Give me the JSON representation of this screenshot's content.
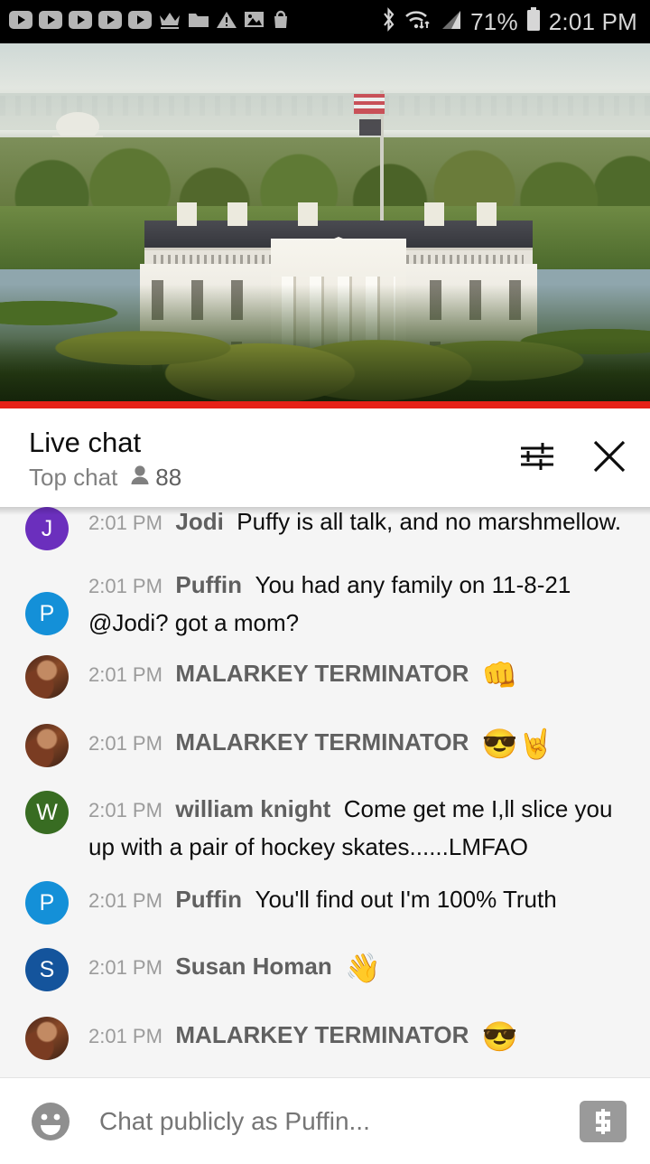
{
  "statusbar": {
    "left_icons": [
      "youtube-play-icon",
      "youtube-play-icon",
      "youtube-play-icon",
      "youtube-play-icon",
      "youtube-play-icon",
      "crown-icon",
      "folder-icon",
      "warning-triangle-icon",
      "image-icon",
      "shopping-bag-icon"
    ],
    "right_icons": [
      "bluetooth-icon",
      "wifi-icon",
      "cellular-signal-icon",
      "battery-icon"
    ],
    "battery_percent": "71%",
    "clock": "2:01 PM"
  },
  "video": {
    "description": "White House live stream with Jefferson Memorial and Potomac River",
    "progress_color": "#e62117"
  },
  "chat_header": {
    "title": "Live chat",
    "subtitle": "Top chat",
    "viewer_count": "88",
    "settings_icon": "tune-sliders-icon",
    "close_icon": "close-icon"
  },
  "messages": [
    {
      "avatar_letter": "J",
      "avatar_color": "#6b2fbd",
      "avatar_type": "letter",
      "time": "2:01 PM",
      "author": "Jodi",
      "text": "Puffy is all talk, and no marshmellow.",
      "emojis": ""
    },
    {
      "avatar_letter": "P",
      "avatar_color": "#1490d8",
      "avatar_type": "letter",
      "time": "2:01 PM",
      "author": "Puffin",
      "text": "You had any family on 11-8-21 @Jodi? got a mom?",
      "emojis": ""
    },
    {
      "avatar_letter": "",
      "avatar_color": "#5a3020",
      "avatar_type": "photo",
      "time": "2:01 PM",
      "author": "MALARKEY TERMINATOR",
      "text": "",
      "emojis": "👊"
    },
    {
      "avatar_letter": "",
      "avatar_color": "#5a3020",
      "avatar_type": "photo",
      "time": "2:01 PM",
      "author": "MALARKEY TERMINATOR",
      "text": "",
      "emojis": "😎🤘"
    },
    {
      "avatar_letter": "W",
      "avatar_color": "#386c22",
      "avatar_type": "letter",
      "time": "2:01 PM",
      "author": "william knight",
      "text": "Come get me I,ll slice you up with a pair of hockey skates......LMFAO",
      "emojis": ""
    },
    {
      "avatar_letter": "P",
      "avatar_color": "#1490d8",
      "avatar_type": "letter",
      "time": "2:01 PM",
      "author": "Puffin",
      "text": "You'll find out I'm 100% Truth",
      "emojis": ""
    },
    {
      "avatar_letter": "S",
      "avatar_color": "#14549c",
      "avatar_type": "letter",
      "time": "2:01 PM",
      "author": "Susan Homan",
      "text": "",
      "emojis": "👋"
    },
    {
      "avatar_letter": "",
      "avatar_color": "#5a3020",
      "avatar_type": "photo",
      "time": "2:01 PM",
      "author": "MALARKEY TERMINATOR",
      "text": "",
      "emojis": "😎"
    }
  ],
  "input_bar": {
    "emoji_icon": "emoji-smiley-icon",
    "placeholder": "Chat publicly as Puffin...",
    "superchat_icon": "dollar-superchat-icon"
  }
}
